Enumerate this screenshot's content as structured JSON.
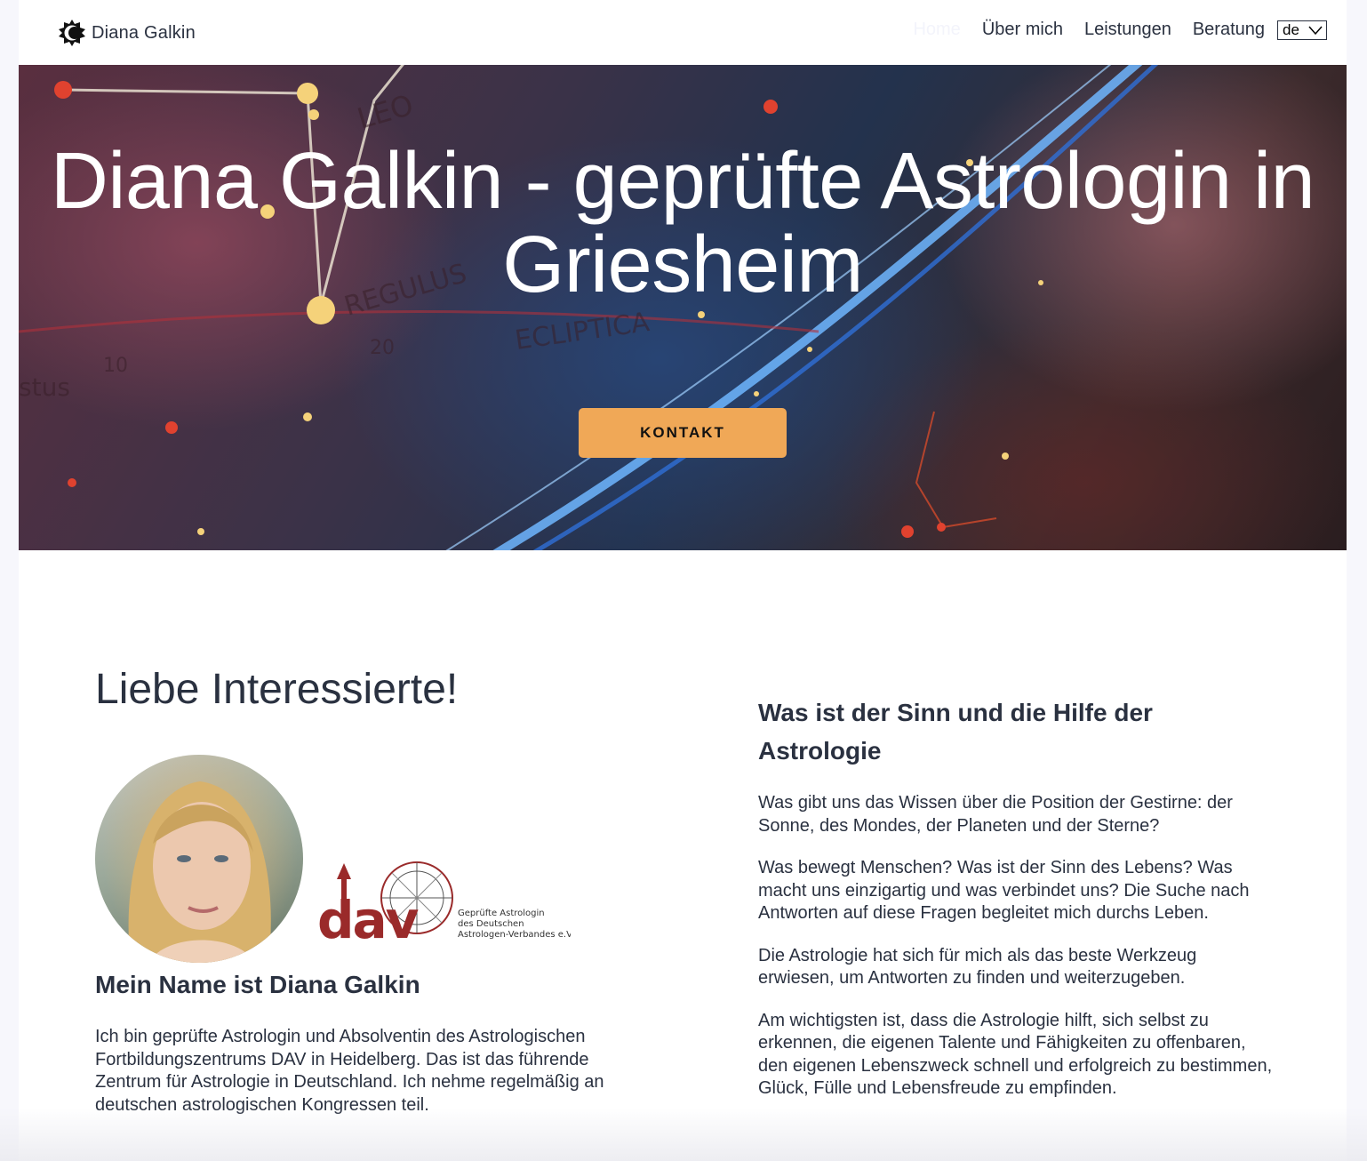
{
  "header": {
    "brand": "Diana Galkin",
    "nav": [
      {
        "label": "Home",
        "active": true
      },
      {
        "label": "Über mich",
        "active": false
      },
      {
        "label": "Leistungen",
        "active": false
      },
      {
        "label": "Beratung",
        "active": false
      }
    ],
    "language": "de"
  },
  "hero": {
    "title": "Diana Galkin - geprüfte Astrologin in Griesheim",
    "cta_label": "KONTAKT",
    "image_labels": [
      "LEO",
      "REGULUS",
      "ECLIPTICA",
      "20",
      "10",
      "stus"
    ]
  },
  "intro": {
    "greeting": "Liebe Interessierte!",
    "dav_logo": {
      "mark": "dav",
      "text_lines": [
        "Geprüfte Astrologin",
        "des Deutschen",
        "Astrologen-Verbandes e.V."
      ]
    },
    "name_heading": "Mein Name ist Diana Galkin",
    "bio": "Ich bin geprüfte Astrologin und Absolventin des Astrologischen Fortbildungszentrums DAV in Heidelberg. Das ist das führende Zentrum für Astrologie in Deutschland. Ich nehme regelmäßig an deutschen astrologischen Kongressen teil."
  },
  "about_astrology": {
    "heading": "Was ist der Sinn und die Hilfe der Astrologie",
    "paragraphs": [
      "Was gibt uns das Wissen über die Position der Gestirne: der Sonne, des Mondes, der Planeten und der Sterne?",
      "Was bewegt Menschen? Was ist der Sinn des Lebens? Was macht uns einzigartig und was verbindet uns? Die Suche nach Antworten auf diese Fragen begleitet mich durchs Leben.",
      "Die Astrologie hat sich für mich als das beste Werkzeug erwiesen, um Antworten zu finden und weiterzugeben.",
      "Am wichtigsten ist, dass die Astrologie hilft, sich selbst zu erkennen, die eigenen Talente und Fähigkeiten zu offenbaren, den eigenen Lebenszweck schnell und erfolgreich zu bestimmen, Glück, Fülle und Lebensfreude zu empfinden."
    ]
  },
  "colors": {
    "accent": "#f0a857",
    "text": "#2a3140",
    "dav_red": "#9a2a2a"
  }
}
